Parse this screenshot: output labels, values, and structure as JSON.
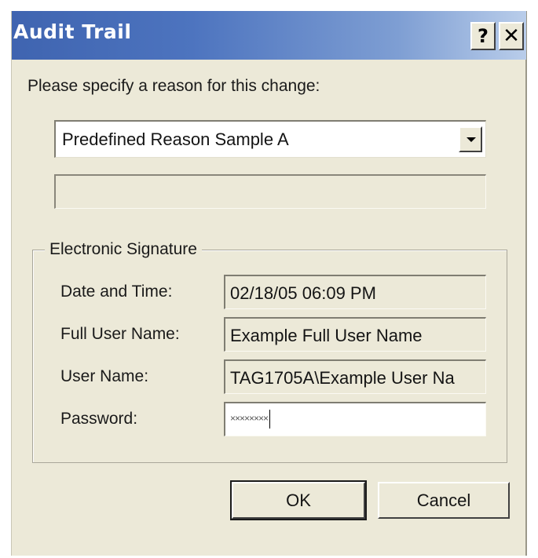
{
  "window": {
    "title": "Audit Trail",
    "help_label": "?",
    "close_label": "✕"
  },
  "prompt": "Please specify a reason for this change:",
  "reason_select": {
    "value": "Predefined Reason Sample A"
  },
  "reason_text": "",
  "signature": {
    "legend": "Electronic Signature",
    "date_time": {
      "label": "Date and Time:",
      "value": "02/18/05  06:09 PM"
    },
    "full_user_name": {
      "label": "Full User Name:",
      "value": "Example Full User Name"
    },
    "user_name": {
      "label": "User Name:",
      "value": "TAG1705A\\Example User Na"
    },
    "password": {
      "label": "Password:",
      "value": "××××××××"
    }
  },
  "buttons": {
    "ok_label": "OK",
    "cancel_label": "Cancel"
  },
  "colors": {
    "titlebar_start": "#3f64b0",
    "titlebar_end": "#b9cdea",
    "dialog_bg": "#ece9d8"
  }
}
